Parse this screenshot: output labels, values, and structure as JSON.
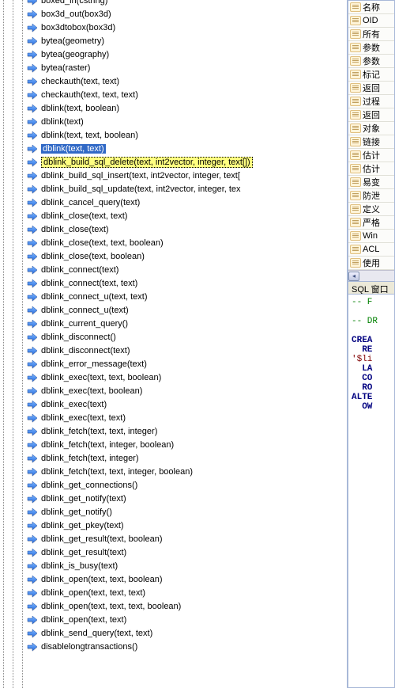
{
  "tree": {
    "items": [
      {
        "label": "box3d_out(box3d)",
        "state": "normal"
      },
      {
        "label": "box3dtobox(box3d)",
        "state": "normal"
      },
      {
        "label": "bytea(geometry)",
        "state": "normal"
      },
      {
        "label": "bytea(geography)",
        "state": "normal"
      },
      {
        "label": "bytea(raster)",
        "state": "normal"
      },
      {
        "label": "checkauth(text, text)",
        "state": "normal"
      },
      {
        "label": "checkauth(text, text, text)",
        "state": "normal"
      },
      {
        "label": "dblink(text, boolean)",
        "state": "normal"
      },
      {
        "label": "dblink(text)",
        "state": "normal"
      },
      {
        "label": "dblink(text, text, boolean)",
        "state": "normal"
      },
      {
        "label": "dblink(text, text)",
        "state": "selected"
      },
      {
        "label": "dblink_build_sql_delete(text, int2vector, integer, text[])",
        "state": "highlighted"
      },
      {
        "label": "dblink_build_sql_insert(text, int2vector, integer, text[",
        "state": "normal"
      },
      {
        "label": "dblink_build_sql_update(text, int2vector, integer, tex",
        "state": "normal"
      },
      {
        "label": "dblink_cancel_query(text)",
        "state": "normal"
      },
      {
        "label": "dblink_close(text, text)",
        "state": "normal"
      },
      {
        "label": "dblink_close(text)",
        "state": "normal"
      },
      {
        "label": "dblink_close(text, text, boolean)",
        "state": "normal"
      },
      {
        "label": "dblink_close(text, boolean)",
        "state": "normal"
      },
      {
        "label": "dblink_connect(text)",
        "state": "normal"
      },
      {
        "label": "dblink_connect(text, text)",
        "state": "normal"
      },
      {
        "label": "dblink_connect_u(text, text)",
        "state": "normal"
      },
      {
        "label": "dblink_connect_u(text)",
        "state": "normal"
      },
      {
        "label": "dblink_current_query()",
        "state": "normal"
      },
      {
        "label": "dblink_disconnect()",
        "state": "normal"
      },
      {
        "label": "dblink_disconnect(text)",
        "state": "normal"
      },
      {
        "label": "dblink_error_message(text)",
        "state": "normal"
      },
      {
        "label": "dblink_exec(text, text, boolean)",
        "state": "normal"
      },
      {
        "label": "dblink_exec(text, boolean)",
        "state": "normal"
      },
      {
        "label": "dblink_exec(text)",
        "state": "normal"
      },
      {
        "label": "dblink_exec(text, text)",
        "state": "normal"
      },
      {
        "label": "dblink_fetch(text, text, integer)",
        "state": "normal"
      },
      {
        "label": "dblink_fetch(text, integer, boolean)",
        "state": "normal"
      },
      {
        "label": "dblink_fetch(text, integer)",
        "state": "normal"
      },
      {
        "label": "dblink_fetch(text, text, integer, boolean)",
        "state": "normal"
      },
      {
        "label": "dblink_get_connections()",
        "state": "normal"
      },
      {
        "label": "dblink_get_notify(text)",
        "state": "normal"
      },
      {
        "label": "dblink_get_notify()",
        "state": "normal"
      },
      {
        "label": "dblink_get_pkey(text)",
        "state": "normal"
      },
      {
        "label": "dblink_get_result(text, boolean)",
        "state": "normal"
      },
      {
        "label": "dblink_get_result(text)",
        "state": "normal"
      },
      {
        "label": "dblink_is_busy(text)",
        "state": "normal"
      },
      {
        "label": "dblink_open(text, text, boolean)",
        "state": "normal"
      },
      {
        "label": "dblink_open(text, text, text)",
        "state": "normal"
      },
      {
        "label": "dblink_open(text, text, text, boolean)",
        "state": "normal"
      },
      {
        "label": "dblink_open(text, text)",
        "state": "normal"
      },
      {
        "label": "dblink_send_query(text, text)",
        "state": "normal"
      },
      {
        "label": "disablelongtransactions()",
        "state": "normal"
      }
    ],
    "first_cutoff": "boxed_in(cstring)"
  },
  "props": {
    "items": [
      "名称",
      "OID",
      "所有",
      "参数",
      "参数",
      "标记",
      "返回",
      "过程",
      "返回",
      "对象",
      "链接",
      "估计",
      "估计",
      "易变",
      "防泄",
      "定义",
      "严格",
      "Win",
      "ACL",
      "使用"
    ]
  },
  "sql": {
    "header": "SQL 窗口",
    "lines": [
      {
        "cls": "sql-comment",
        "text": "-- F"
      },
      {
        "cls": "",
        "text": ""
      },
      {
        "cls": "sql-comment",
        "text": "-- DR"
      },
      {
        "cls": "",
        "text": ""
      },
      {
        "cls": "sql-keyword",
        "text": "CREA"
      },
      {
        "cls": "sql-keyword",
        "text": "  RE"
      },
      {
        "cls": "sql-string",
        "text": "'$li"
      },
      {
        "cls": "sql-keyword",
        "text": "  LA"
      },
      {
        "cls": "sql-keyword",
        "text": "  CO"
      },
      {
        "cls": "sql-keyword",
        "text": "  RO"
      },
      {
        "cls": "sql-keyword",
        "text": "ALTE"
      },
      {
        "cls": "sql-keyword",
        "text": "  OW"
      }
    ]
  }
}
